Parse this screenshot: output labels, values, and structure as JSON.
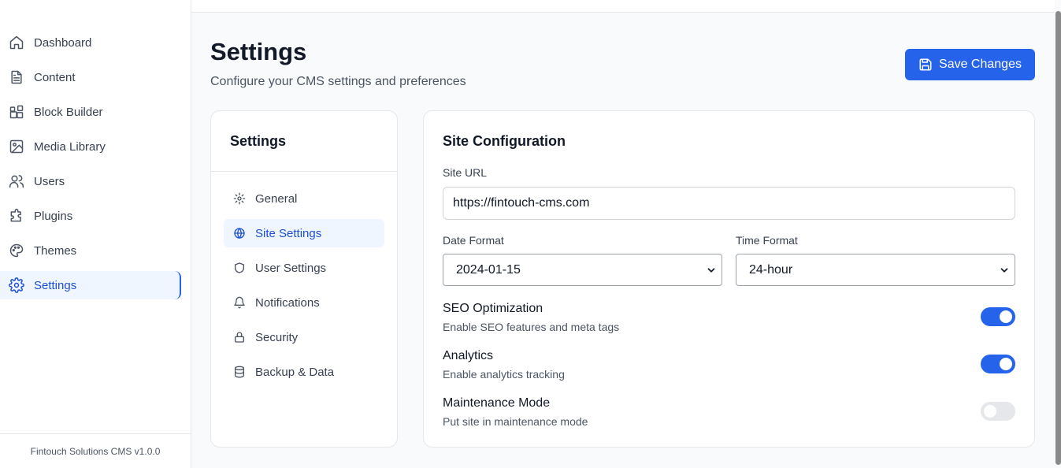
{
  "sidebar": {
    "items": [
      {
        "label": "Dashboard",
        "icon": "home-icon"
      },
      {
        "label": "Content",
        "icon": "document-icon"
      },
      {
        "label": "Block Builder",
        "icon": "blocks-icon"
      },
      {
        "label": "Media Library",
        "icon": "image-icon"
      },
      {
        "label": "Users",
        "icon": "users-icon"
      },
      {
        "label": "Plugins",
        "icon": "puzzle-icon"
      },
      {
        "label": "Themes",
        "icon": "palette-icon"
      },
      {
        "label": "Settings",
        "icon": "gear-icon",
        "active": true
      }
    ],
    "footer": "Fintouch Solutions CMS v1.0.0"
  },
  "header": {
    "title": "Settings",
    "subtitle": "Configure your CMS settings and preferences",
    "save_label": "Save Changes"
  },
  "subnav": {
    "title": "Settings",
    "items": [
      {
        "label": "General",
        "icon": "gear-icon"
      },
      {
        "label": "Site Settings",
        "icon": "globe-icon",
        "active": true
      },
      {
        "label": "User Settings",
        "icon": "shield-icon"
      },
      {
        "label": "Notifications",
        "icon": "bell-icon"
      },
      {
        "label": "Security",
        "icon": "lock-icon"
      },
      {
        "label": "Backup & Data",
        "icon": "database-icon"
      }
    ]
  },
  "site_config": {
    "title": "Site Configuration",
    "site_url_label": "Site URL",
    "site_url_value": "https://fintouch-cms.com",
    "date_format_label": "Date Format",
    "date_format_value": "2024-01-15",
    "time_format_label": "Time Format",
    "time_format_value": "24-hour",
    "toggles": [
      {
        "title": "SEO Optimization",
        "description": "Enable SEO features and meta tags",
        "enabled": true
      },
      {
        "title": "Analytics",
        "description": "Enable analytics tracking",
        "enabled": true
      },
      {
        "title": "Maintenance Mode",
        "description": "Put site in maintenance mode",
        "enabled": false
      }
    ]
  },
  "colors": {
    "accent": "#2563eb",
    "active_bg": "#eff6ff",
    "active_text": "#1d4ed8"
  }
}
